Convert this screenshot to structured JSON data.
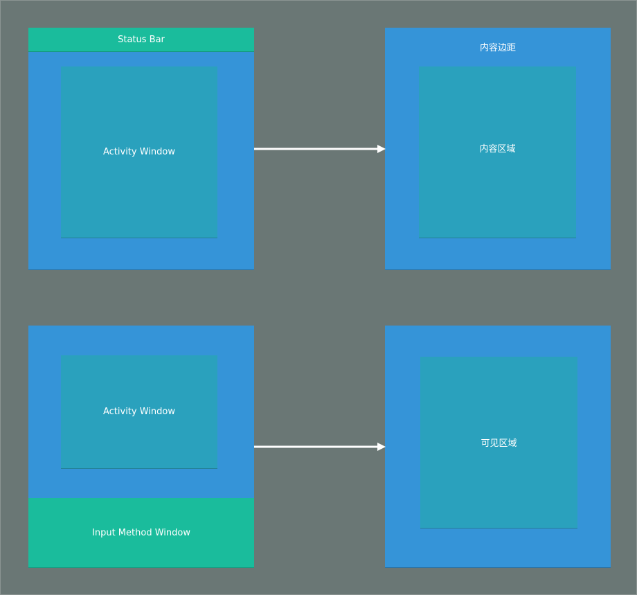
{
  "diagram": {
    "top_left": {
      "status_bar_label": "Status Bar",
      "activity_label": "Activity Window"
    },
    "top_right": {
      "padding_label": "内容边距",
      "content_label": "内容区域"
    },
    "bottom_left": {
      "activity_label": "Activity Window",
      "input_method_label": "Input Method Window"
    },
    "bottom_right": {
      "visible_label": "可见区域"
    }
  },
  "colors": {
    "background": "#6a7775",
    "panel": "#3594d8",
    "inner": "#2aa1bd",
    "teal": "#1abc9c",
    "arrow": "#ffffff"
  }
}
